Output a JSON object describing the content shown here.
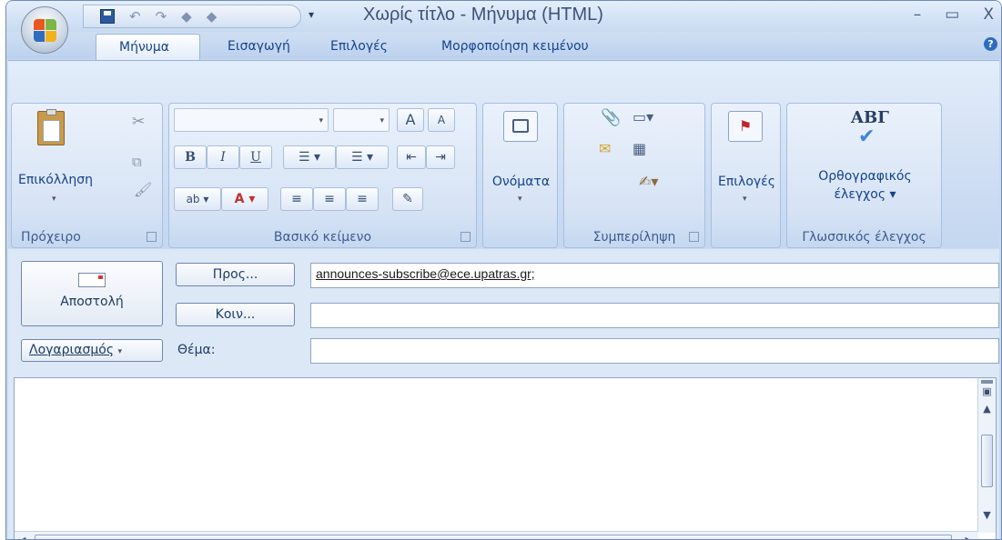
{
  "window": {
    "title": "Χωρίς τίτλο - Μήνυμα (HTML)",
    "controls": [
      "–",
      "▭",
      "X"
    ]
  },
  "qat": {
    "undo_icon": "undo-icon",
    "redo_icon": "redo-icon",
    "more": "▾"
  },
  "tabs": [
    {
      "label": "Μήνυμα",
      "active": true
    },
    {
      "label": "Εισαγωγή"
    },
    {
      "label": "Επιλογές"
    },
    {
      "label": "Μορφοποίηση κειμένου"
    }
  ],
  "ribbon": {
    "clipboard": {
      "label": "Πρόχειρο",
      "paste": "Επικόλληση"
    },
    "basic_text": {
      "label": "Βασικό κείμενο",
      "bold": "B",
      "italic": "I",
      "underline": "U",
      "grow": "A",
      "shrink": "A",
      "highlight": "ab",
      "font_color": "A"
    },
    "names": {
      "label": "Ονόματα"
    },
    "include": {
      "label": "Συμπερίληψη"
    },
    "options": {
      "label": "Επιλογές"
    },
    "proofing": {
      "label": "Γλωσσικός έλεγχος",
      "icon_text": "ΑΒΓ",
      "spelling_line1": "Ορθογραφικός",
      "spelling_line2": "έλεγχος"
    }
  },
  "compose": {
    "send": "Αποστολή",
    "to_button": "Προς...",
    "cc_button": "Κοιν...",
    "account": "Λογαριασμός",
    "subject_label": "Θέμα:",
    "to_value": "announces-subscribe@ece.upatras.gr;",
    "cc_value": "",
    "subject_value": ""
  },
  "colors": {
    "accent": "#15428b",
    "ribbon": "#dbe7f7"
  }
}
